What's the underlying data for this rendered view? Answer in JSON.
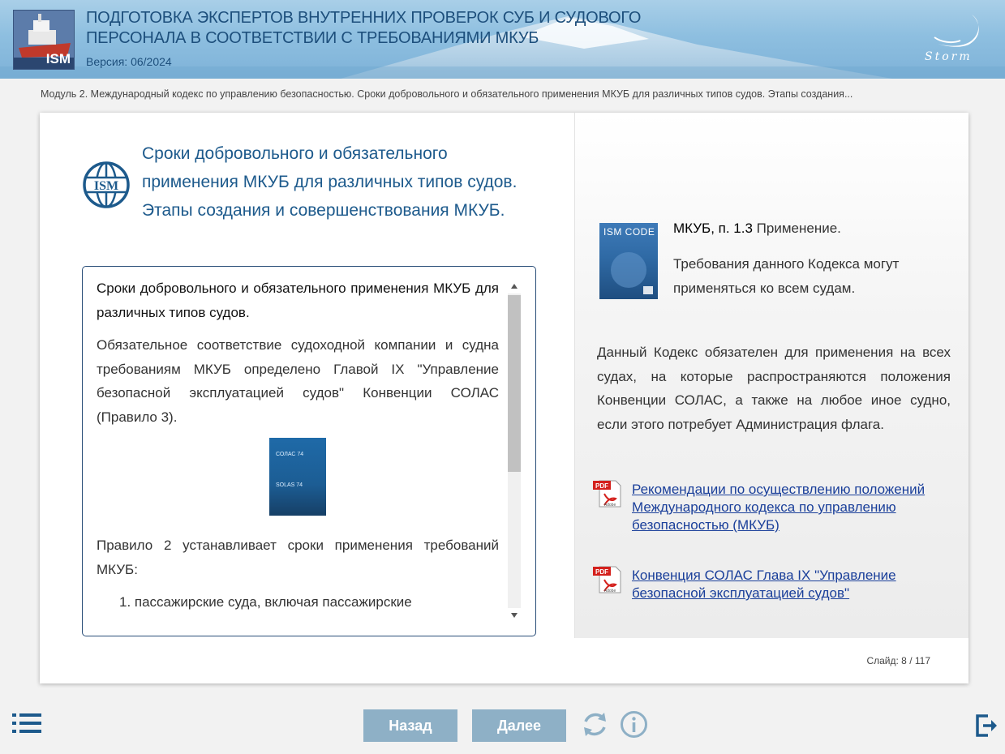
{
  "header": {
    "title": "ПОДГОТОВКА ЭКСПЕРТОВ ВНУТРЕННИХ ПРОВЕРОК СУБ И СУДОВОГО ПЕРСОНАЛА В СООТВЕТСТВИИ С ТРЕБОВАНИЯМИ МКУБ",
    "version": "Версия: 06/2024",
    "logo_text": "ISM",
    "brand": "Storm"
  },
  "breadcrumb": "Модуль 2. Международный кодекс по управлению безопасностью. Сроки добровольного и обязательного применения МКУБ для различных типов судов. Этапы создания...",
  "slide": {
    "badge_text": "ISM",
    "title": "Сроки добровольного и обязательного применения МКУБ для различных типов судов. Этапы создания и совершенствования МКУБ.",
    "scroll": {
      "lead": "Сроки добровольного и обязательного применения МКУБ для различных типов судов.",
      "para1": "Обязательное соответствие судоходной компании и судна требованиям МКУБ определено Главой IX \"Управление безопасной эксплуатацией судов\" Конвенции СОЛАС (Правило 3).",
      "solas_cover": {
        "line1": "СОЛАС 74",
        "line2": "SOLAS 74"
      },
      "para2": "Правило 2 устанавливает сроки применения требований МКУБ:",
      "list_item1": "1. пассажирские суда, включая пассажирские"
    },
    "right": {
      "book_title": "ISM CODE",
      "ref_bold": "МКУБ, п. 1.3",
      "ref_rest": " Применение.",
      "ref_desc": "Требования данного Кодекса могут применяться ко всем судам.",
      "paragraph": "Данный Кодекс обязателен для применения на всех судах, на которые распространяются положения Конвенции СОЛАС, а также на любое иное судно, если этого потребует Администрация флага.",
      "links": [
        {
          "text": "Рекомендации по осуществлению положений Международного кодекса по управлению безопасностью (МКУБ)"
        },
        {
          "text": "Конвенция СОЛАС Глава IX \"Управление безопасной эксплуатацией судов\""
        }
      ],
      "pdf_label": "PDF",
      "adobe_label": "Adobe"
    },
    "counter": "Слайд:  8 / 117"
  },
  "nav": {
    "back": "Назад",
    "next": "Далее"
  },
  "colors": {
    "accent": "#1d5a8c",
    "nav_button": "#8eb0c6",
    "link": "#1a3f9a",
    "icon": "#1d5a8c"
  }
}
